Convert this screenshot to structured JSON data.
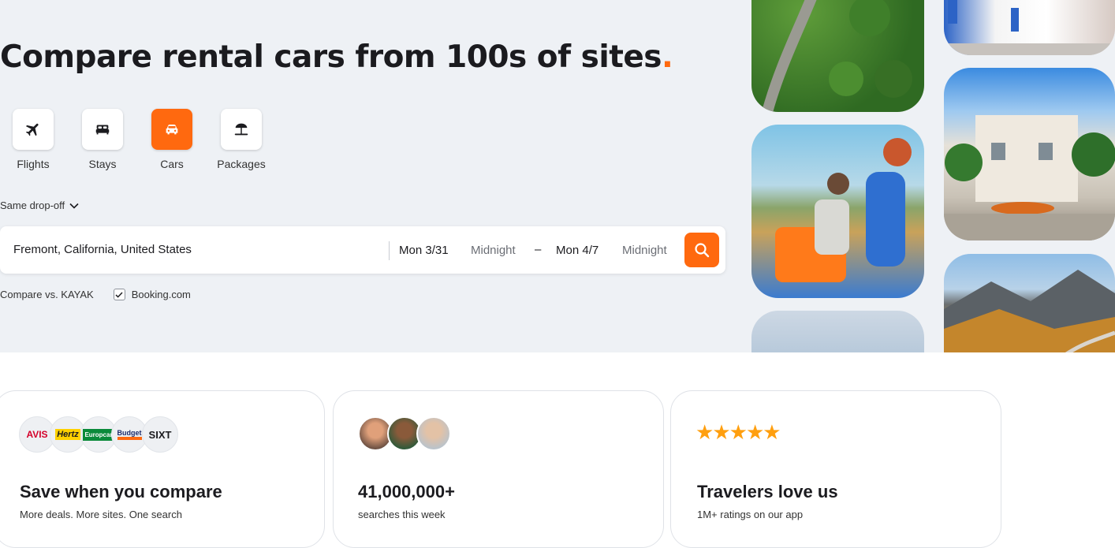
{
  "hero": {
    "headline": "Compare rental cars from 100s of sites",
    "headline_dot": ".",
    "accent_color": "#ff690f"
  },
  "verticals": [
    {
      "label": "Flights",
      "icon": "plane-icon",
      "active": false
    },
    {
      "label": "Stays",
      "icon": "bed-icon",
      "active": false
    },
    {
      "label": "Cars",
      "icon": "car-icon",
      "active": true
    },
    {
      "label": "Packages",
      "icon": "beach-umbrella-icon",
      "active": false
    }
  ],
  "dropoff": {
    "label": "Same drop-off"
  },
  "search": {
    "location": "Fremont, California, United States",
    "pickup_date": "Mon 3/31",
    "pickup_time": "Midnight",
    "separator": "–",
    "dropoff_date": "Mon 4/7",
    "dropoff_time": "Midnight",
    "button_icon": "search-icon"
  },
  "compare": {
    "label": "Compare vs. KAYAK",
    "option_label": "Booking.com",
    "option_checked": true
  },
  "cards": [
    {
      "title": "Save when you compare",
      "subtitle": "More deals. More sites. One search"
    },
    {
      "title": "41,000,000+",
      "subtitle": "searches this week"
    },
    {
      "title": "Travelers love us",
      "subtitle": "1M+ ratings on our app"
    }
  ],
  "brand_logos": [
    "AVIS",
    "Hertz",
    "Europcar",
    "Budget",
    "SIXT"
  ],
  "rating_stars": 5
}
